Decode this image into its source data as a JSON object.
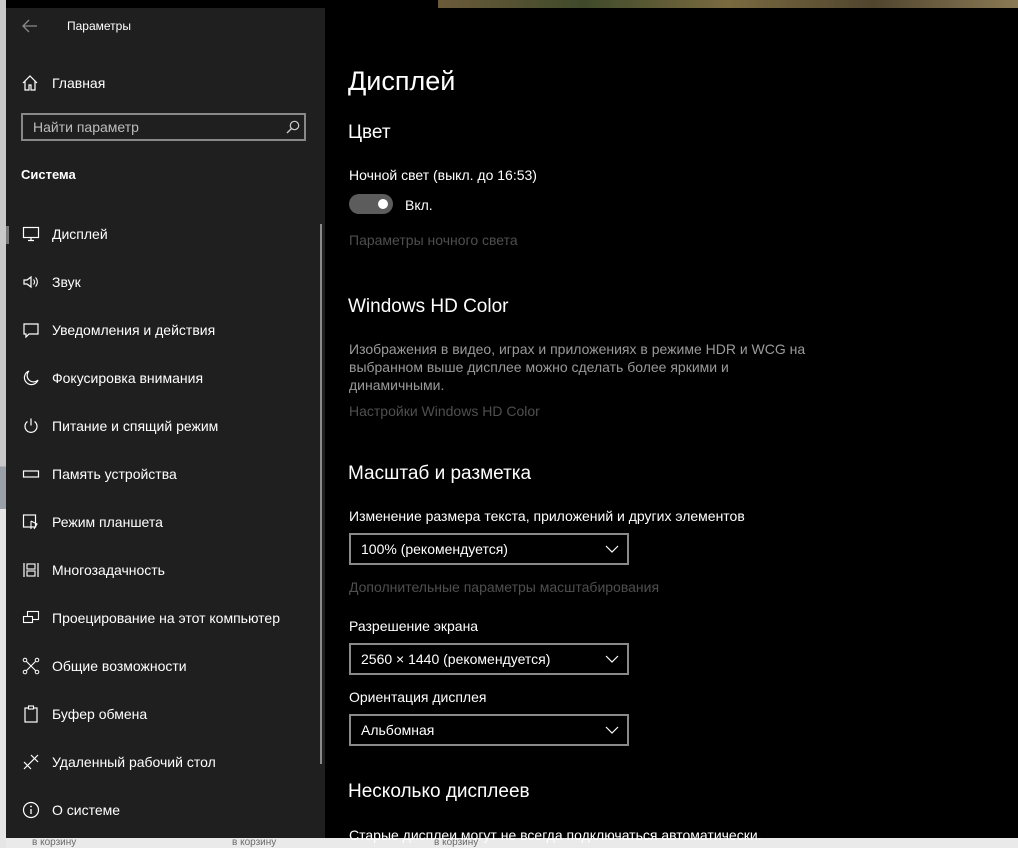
{
  "window": {
    "title": "Параметры"
  },
  "sidebar": {
    "home_label": "Главная",
    "search_placeholder": "Найти параметр",
    "section_title": "Система",
    "items": [
      {
        "label": "Дисплей",
        "icon": "monitor-icon",
        "active": true
      },
      {
        "label": "Звук",
        "icon": "speaker-icon"
      },
      {
        "label": "Уведомления и действия",
        "icon": "notification-icon"
      },
      {
        "label": "Фокусировка внимания",
        "icon": "moon-icon"
      },
      {
        "label": "Питание и спящий режим",
        "icon": "power-icon"
      },
      {
        "label": "Память устройства",
        "icon": "storage-icon"
      },
      {
        "label": "Режим планшета",
        "icon": "tablet-icon"
      },
      {
        "label": "Многозадачность",
        "icon": "multitasking-icon"
      },
      {
        "label": "Проецирование на этот компьютер",
        "icon": "project-icon"
      },
      {
        "label": "Общие возможности",
        "icon": "shared-experiences-icon"
      },
      {
        "label": "Буфер обмена",
        "icon": "clipboard-icon"
      },
      {
        "label": "Удаленный рабочий стол",
        "icon": "remote-desktop-icon"
      },
      {
        "label": "О системе",
        "icon": "info-icon"
      }
    ]
  },
  "main": {
    "page_title": "Дисплей",
    "color": {
      "heading": "Цвет",
      "night_light_label": "Ночной свет (выкл. до 16:53)",
      "toggle_state_label": "Вкл.",
      "night_light_settings_link": "Параметры ночного света"
    },
    "hd_color": {
      "heading": "Windows HD Color",
      "description": "Изображения в видео, играх и приложениях в режиме HDR и WCG на выбранном выше дисплее можно сделать более яркими и динамичными.",
      "settings_link": "Настройки Windows HD Color"
    },
    "scale": {
      "heading": "Масштаб и разметка",
      "size_label": "Изменение размера текста, приложений и других элементов",
      "size_value": "100% (рекомендуется)",
      "advanced_link": "Дополнительные параметры масштабирования",
      "resolution_label": "Разрешение экрана",
      "resolution_value": "2560 × 1440 (рекомендуется)",
      "orientation_label": "Ориентация дисплея",
      "orientation_value": "Альбомная"
    },
    "multi": {
      "heading": "Несколько дисплеев",
      "text": "Старые дисплеи могут не всегда подключаться автоматически."
    }
  },
  "desktop": {
    "bottom_label": "в корзину"
  }
}
